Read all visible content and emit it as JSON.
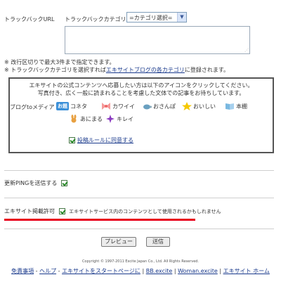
{
  "trackback": {
    "label": "トラックバックURL",
    "category_label": "トラックバックカテゴリ：",
    "category_selected": "=カテゴリ選択=",
    "note1": "※ 改行区切りで最大3件まで指定できます。",
    "note2_prefix": "※ トラックバックカテゴリを選択すれば",
    "note2_link": "エキサイトブログの各カテゴリ",
    "note2_suffix": "に登録されます。"
  },
  "box": {
    "line1": "エキサイトの公式コンテンツへ応募したい方は以下のアイコンをクリックしてください。",
    "line2": "写真付き、広く一般に読まれることを考慮した文体での記事をお待ちしています。",
    "media_label": "ブログtoメディア",
    "items": [
      {
        "name": "お題",
        "label": "コネタ"
      },
      {
        "name": "ribbon",
        "label": "カワイイ"
      },
      {
        "name": "turtle",
        "label": "おさんぽ"
      },
      {
        "name": "star",
        "label": "おいしい"
      },
      {
        "name": "book",
        "label": "本棚"
      },
      {
        "name": "rabbit",
        "label": "あにまる"
      },
      {
        "name": "sparkle",
        "label": "キレイ"
      }
    ],
    "agree_link": "投稿ルールに同意する"
  },
  "ping": {
    "label": "更新PINGを送信する"
  },
  "excite": {
    "label": "エキサイト掲載許可",
    "note": "エキサイトサービス内のコンテンツとして使用されるかもしれません"
  },
  "buttons": {
    "preview": "プレビュー",
    "send": "送信"
  },
  "copyright": "Copyright © 1997-2011 Excite Japan Co., Ltd. All Rights Reserved.",
  "footer": {
    "links": [
      "免責事項",
      "ヘルプ",
      "エキサイトをスタートページに",
      "BB.excite",
      "Woman.excite",
      "エキサイト ホーム"
    ]
  },
  "colors": {
    "accent_red": "#e8001c",
    "link": "#1a3a8c"
  }
}
